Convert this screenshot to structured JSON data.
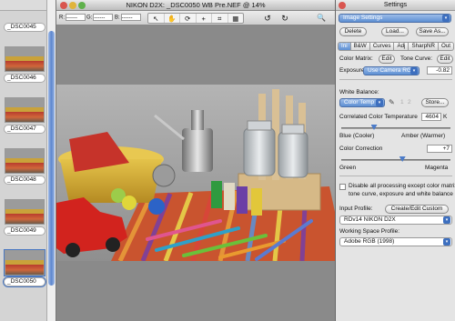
{
  "filmstrip": {
    "items": [
      {
        "label": "_DSC0045"
      },
      {
        "label": "_DSC0046"
      },
      {
        "label": "_DSC0047"
      },
      {
        "label": "_DSC0048"
      },
      {
        "label": "_DSC0049"
      },
      {
        "label": "_DSC0050",
        "selected": true
      }
    ]
  },
  "image_window": {
    "title": "NIKON D2X:  _DSC0050 WB Pre.NEF @ 14%",
    "rgb": {
      "r_label": "R:",
      "r_value": "------",
      "g_label": "G:",
      "g_value": "------",
      "b_label": "B:",
      "b_value": "------"
    },
    "tools": [
      "↖",
      "✋",
      "⟳",
      "+",
      "⌗",
      "▦"
    ],
    "rotate_left": "↺",
    "rotate_right": "↻",
    "zoom": "🔍"
  },
  "settings": {
    "window_title": "Settings",
    "preset": "Image Settings",
    "buttons": {
      "delete": "Delete",
      "load": "Load...",
      "save_as": "Save As..."
    },
    "tabs": [
      {
        "label": "Ini",
        "active": true
      },
      {
        "label": "B&W"
      },
      {
        "label": "Curves"
      },
      {
        "label": "Adj"
      },
      {
        "label": "SharpNR"
      },
      {
        "label": "Out"
      }
    ],
    "color_matrix_label": "Color Matrix:",
    "tone_curve_label": "Tone Curve:",
    "edit_label": "Edit",
    "exposure_label": "Exposure",
    "exposure_mode": "Use Camera RGB",
    "exposure_value": "-0.82",
    "white_balance_label": "White Balance:",
    "wb_mode": "Color Temp",
    "wb_slot1": "1",
    "wb_slot2": "2",
    "store_label": "Store...",
    "cct_label": "Correlated Color Temperature",
    "cct_value": "4604",
    "cct_unit": "K",
    "cct_fraction": 0.3,
    "blue_label": "Blue (Cooler)",
    "amber_label": "Amber (Warmer)",
    "color_correction_label": "Color Correction",
    "color_correction_value": "+7",
    "color_correction_fraction": 0.56,
    "green_label": "Green",
    "magenta_label": "Magenta",
    "disable_label_1": "Disable all processing except color matrix,",
    "disable_label_2": "tone curve, exposure and white balance",
    "input_profile_label": "Input Profile:",
    "create_custom_label": "Create/Edit Custom",
    "input_profile_value": "RDv14 NIKON D2X",
    "working_space_label": "Working Space Profile:",
    "working_space_value": "Adobe RGB (1998)"
  }
}
